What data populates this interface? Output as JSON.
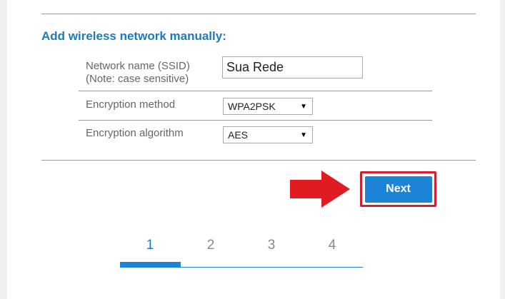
{
  "form": {
    "heading": "Add wireless network manually:",
    "ssid_label_line1": "Network name (SSID)",
    "ssid_label_line2": "(Note: case sensitive)",
    "ssid_value": "Sua Rede",
    "encryption_method_label": "Encryption method",
    "encryption_method_value": "WPA2PSK",
    "encryption_algorithm_label": "Encryption algorithm",
    "encryption_algorithm_value": "AES"
  },
  "actions": {
    "next_label": "Next",
    "arrow_color": "#e01b22",
    "highlight_color": "#d0202f"
  },
  "stepper": {
    "steps": [
      "1",
      "2",
      "3",
      "4"
    ],
    "current_step": 1,
    "progress": 0.25
  },
  "colors": {
    "accent": "#1c84d6",
    "heading": "#1b7bbf"
  }
}
